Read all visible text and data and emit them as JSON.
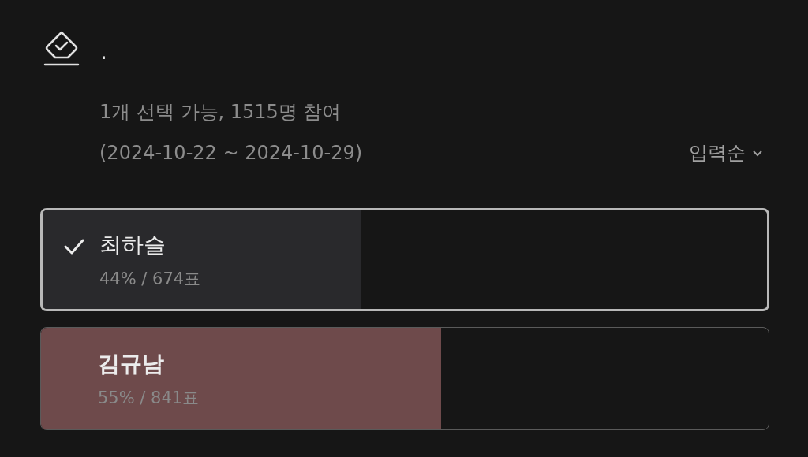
{
  "poll": {
    "title": ".",
    "info": "1개 선택 가능, 1515명 참여",
    "period": "(2024-10-22 ~ 2024-10-29)",
    "sort": "입력순",
    "options": [
      {
        "name": "최하슬",
        "result": "44% / 674표",
        "level": 0.44,
        "selected": true,
        "leading": false
      },
      {
        "name": "김규남",
        "result": "55% / 841표",
        "level": 0.55,
        "selected": false,
        "leading": true
      }
    ]
  }
}
